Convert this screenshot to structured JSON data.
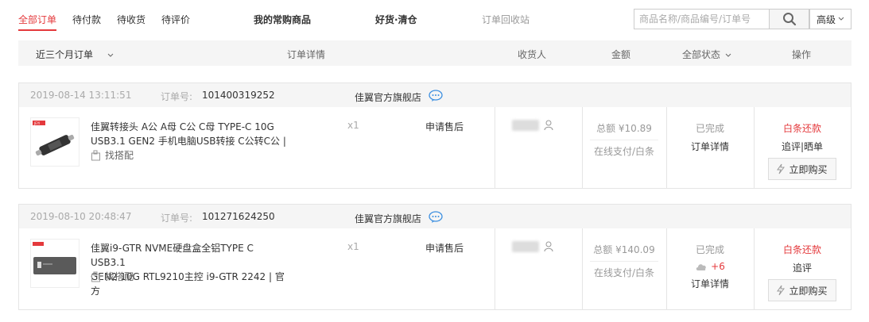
{
  "tabs": {
    "all": "全部订单",
    "unpaid": "待付款",
    "unreceived": "待收货",
    "unreviewed": "待评价",
    "frequent": "我的常购商品",
    "clearance": "好货·清仓",
    "recycle": "订单回收站"
  },
  "search": {
    "placeholder": "商品名称/商品编号/订单号",
    "advanced": "高级"
  },
  "table_header": {
    "period": "近三个月订单",
    "detail": "订单详情",
    "receiver": "收货人",
    "amount": "金额",
    "status": "全部状态",
    "action": "操作"
  },
  "orders": [
    {
      "date": "2019-08-14 13:11:51",
      "order_no_label": "订单号:",
      "order_no": "101400319252",
      "shop": "佳翼官方旗舰店",
      "title_line1": "佳翼转接头 A公 A母 C公 C母 TYPE-C 10G",
      "title_line2": "USB3.1 GEN2 手机电脑USB转接 C公转C公 |",
      "match": "找搭配",
      "qty": "x1",
      "service": "申请售后",
      "total": "总额 ¥10.89",
      "payment": "在线支付/白条",
      "status": "已完成",
      "status_link": "订单详情",
      "op_primary": "白条还款",
      "op_secondary": "追评|晒单",
      "buy": "立即购买"
    },
    {
      "date": "2019-08-10 20:48:47",
      "order_no_label": "订单号:",
      "order_no": "101271624250",
      "shop": "佳翼官方旗舰店",
      "title_line1": "佳翼i9-GTR NVME硬盘盒全铝TYPE C USB3.1",
      "title_line2": "GEN2 10G RTL9210主控 i9-GTR 2242 | 官方",
      "match": "找搭配",
      "qty": "x1",
      "service": "申请售后",
      "total": "总额 ¥140.09",
      "payment": "在线支付/白条",
      "status": "已完成",
      "cloud_count": "+6",
      "status_link": "订单详情",
      "op_primary": "白条还款",
      "op_secondary": "追评",
      "buy": "立即购买"
    }
  ],
  "colors": {
    "accent": "#e4393c",
    "muted": "#999999",
    "header_bg": "#f5f5f5"
  }
}
